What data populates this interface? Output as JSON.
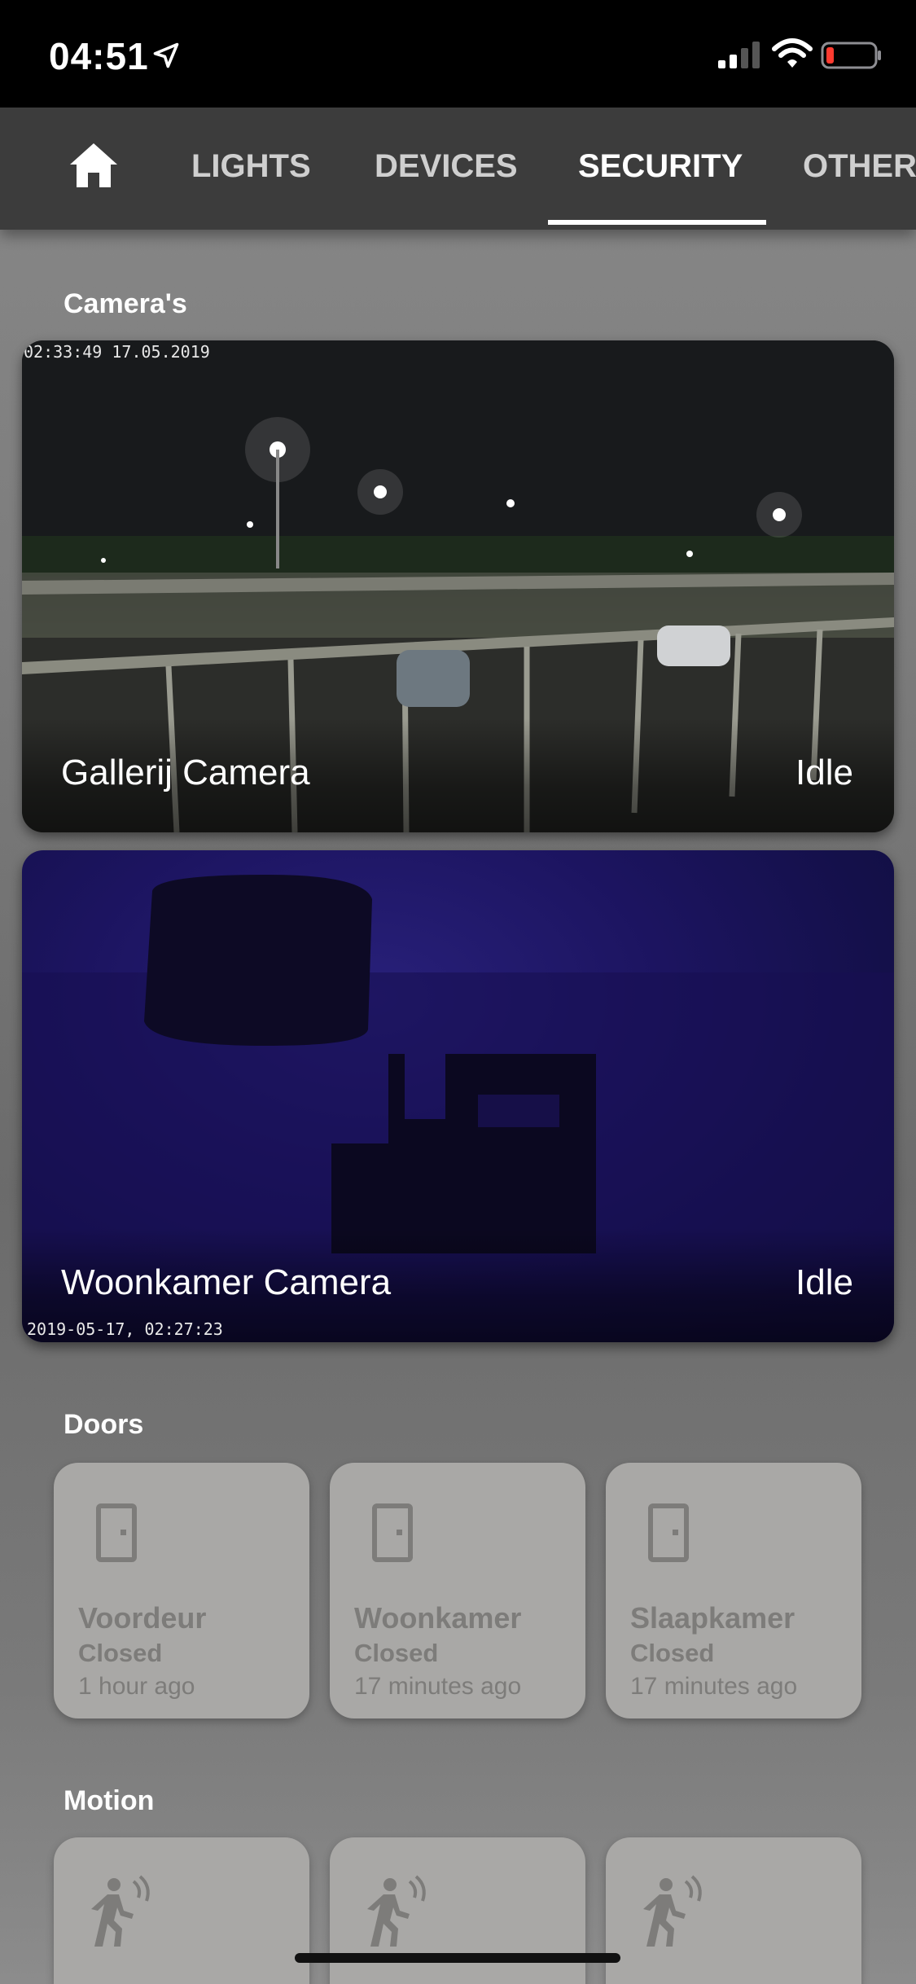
{
  "status_bar": {
    "time": "04:51"
  },
  "tabs": [
    {
      "label": "LIGHTS"
    },
    {
      "label": "DEVICES"
    },
    {
      "label": "SECURITY",
      "active": true
    },
    {
      "label": "OTHER"
    }
  ],
  "cameras_section": {
    "title": "Camera's"
  },
  "cameras": [
    {
      "name": "Gallerij Camera",
      "state": "Idle",
      "timestamp": "02:33:49 17.05.2019"
    },
    {
      "name": "Woonkamer Camera",
      "state": "Idle",
      "timestamp": "2019-05-17, 02:27:23"
    }
  ],
  "doors_section": {
    "title": "Doors"
  },
  "doors": [
    {
      "name": "Voordeur",
      "state": "Closed",
      "time": "1 hour ago"
    },
    {
      "name": "Woonkamer",
      "state": "Closed",
      "time": "17 minutes ago"
    },
    {
      "name": "Slaapkamer",
      "state": "Closed",
      "time": "17 minutes ago"
    }
  ],
  "motion_section": {
    "title": "Motion"
  },
  "icons": {
    "home": "home-icon",
    "door": "door-icon",
    "motion": "motion-sensor-icon",
    "location": "location-arrow-icon",
    "signal": "cellular-signal-icon",
    "wifi": "wifi-icon",
    "battery": "battery-low-icon"
  },
  "colors": {
    "battery_low": "#ff3b30",
    "tab_bar": "#3c3c3c",
    "tile_bg": "#a9a8a6",
    "tile_text": "#7d7c7a"
  }
}
